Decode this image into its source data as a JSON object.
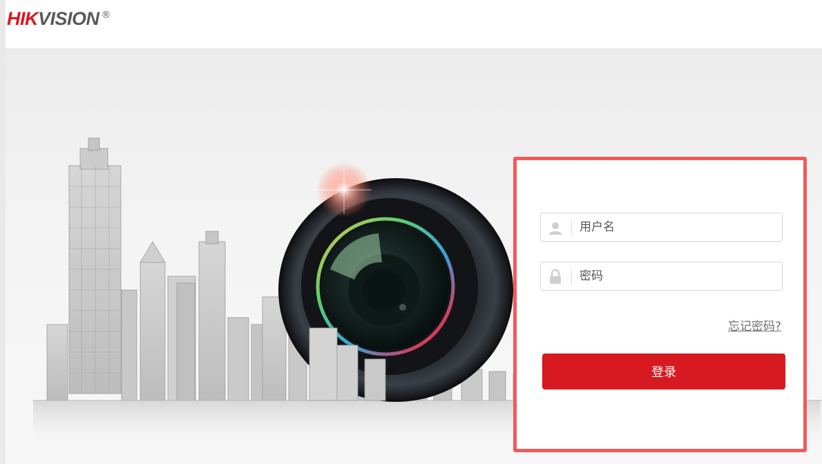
{
  "brand": {
    "logo_primary": "HIK",
    "logo_secondary": "VISION",
    "logo_registered": "®",
    "accent_color": "#d71920",
    "panel_border_color": "#f25a5a"
  },
  "login": {
    "username_placeholder": "用户名",
    "password_placeholder": "密码",
    "forgot_password": "忘记密码?",
    "submit_label": "登录",
    "icons": {
      "username": "user-icon",
      "password": "lock-icon"
    }
  },
  "hero": {
    "illustration": "city-skyline-with-camera-lens"
  }
}
